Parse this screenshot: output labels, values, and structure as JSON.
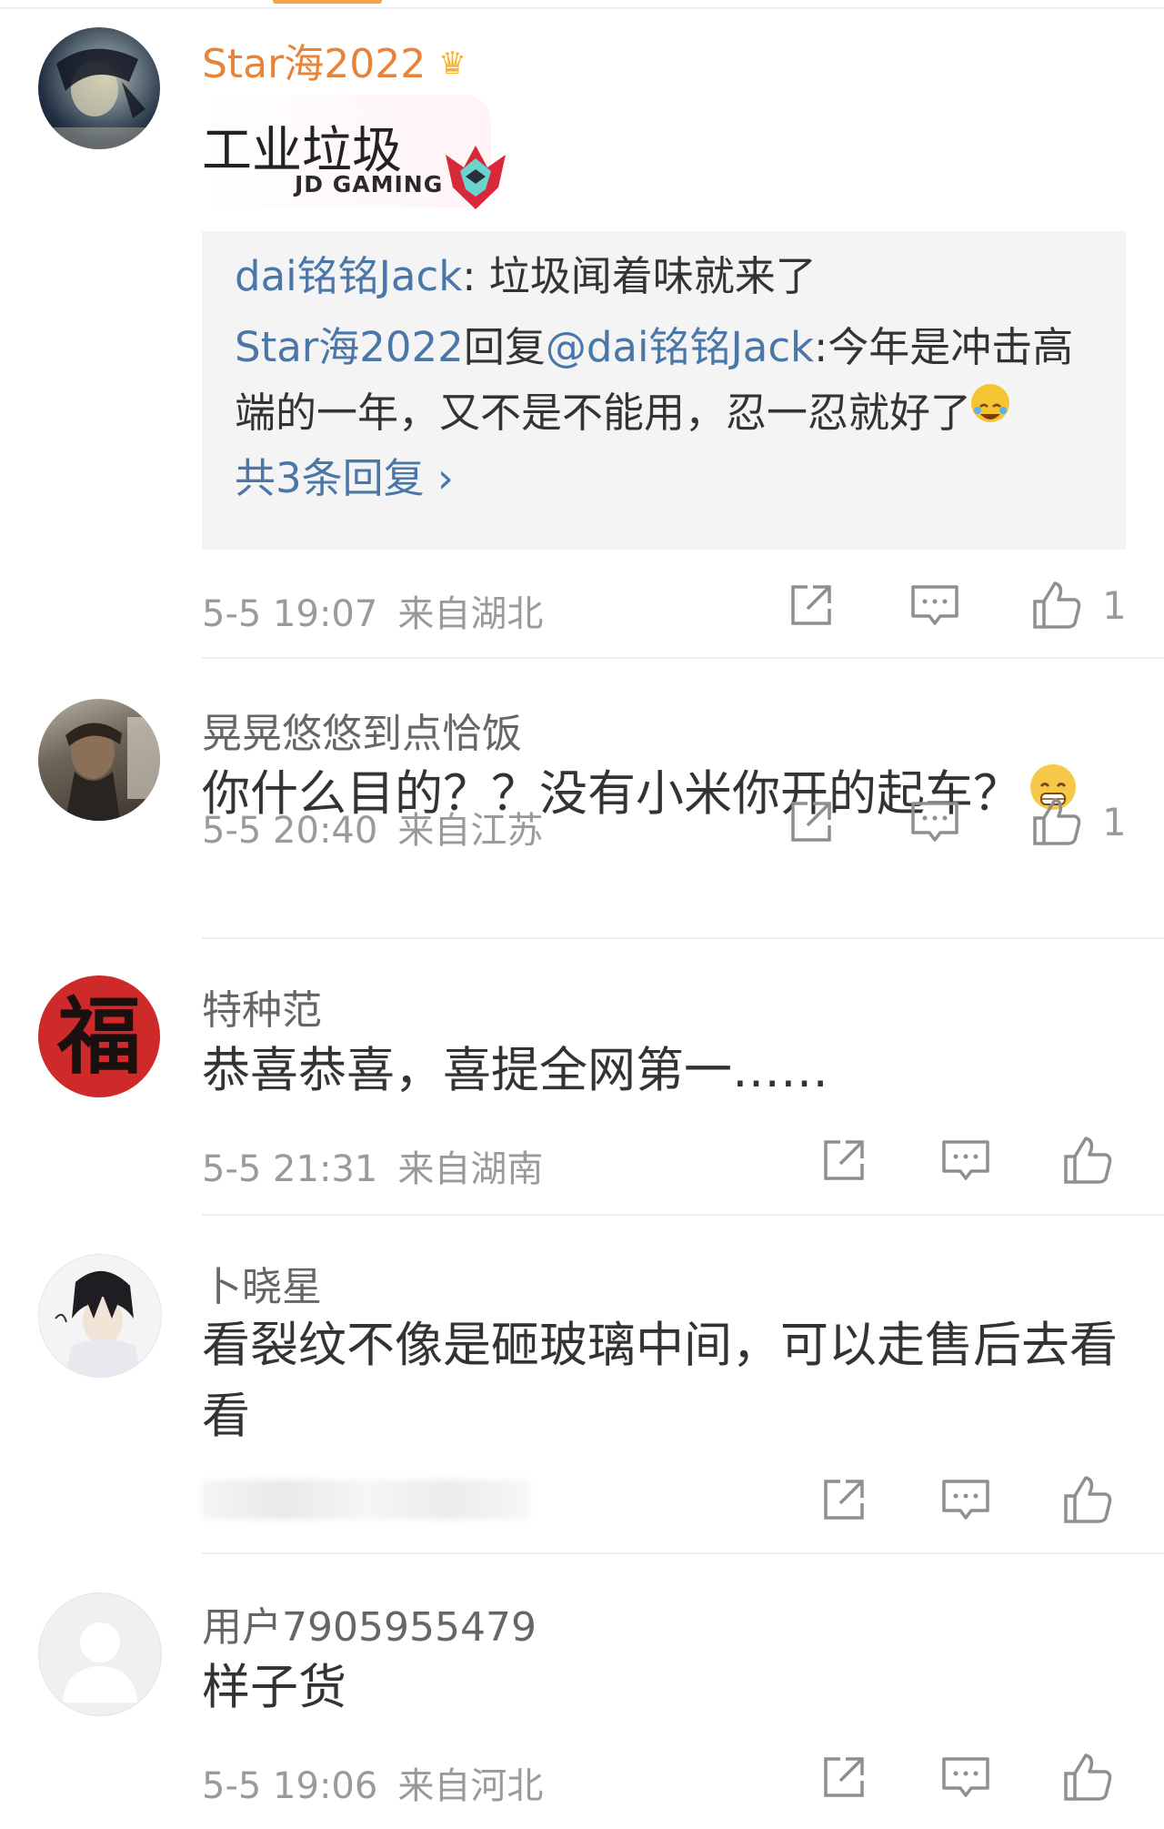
{
  "comments": [
    {
      "username": "Star海2022",
      "sticker": {
        "text": "工业垃圾",
        "brand": "JD GAMING"
      },
      "replies": {
        "line1_user": "dai铭铭Jack",
        "line1_text": ": 垃圾闻着味就来了",
        "line2_user": "Star海2022",
        "line2_mid": "回复",
        "line2_at": "@dai铭铭Jack",
        "line2_text": ":今年是冲击高端的一年，又不是不能用，忍一忍就好了",
        "more": "共3条回复 ›"
      },
      "time": "5-5 19:07",
      "location": "来自湖北",
      "likes": "1"
    },
    {
      "username": "晃晃悠悠到点恰饭",
      "text": "你什么目的？？没有小米你开的起车？",
      "time": "5-5 20:40",
      "location": "来自江苏",
      "likes": "1"
    },
    {
      "username": "特种范",
      "avatar_text": "福",
      "text": "恭喜恭喜，喜提全网第一……",
      "time": "5-5 21:31",
      "location": "来自湖南",
      "likes": ""
    },
    {
      "username": "卜晓星",
      "text": "看裂纹不像是砸玻璃中间，可以走售后去看看",
      "time": "",
      "location": "",
      "likes": ""
    },
    {
      "username": "用户7905955479",
      "text": "样子货",
      "time": "5-5 19:06",
      "location": "来自河北",
      "likes": ""
    }
  ],
  "icons": {
    "share": "share-icon",
    "comment": "comment-icon",
    "like": "thumbs-up-icon",
    "vip": "crown-icon"
  },
  "colors": {
    "vip_name": "#e8833a",
    "link": "#4a76a8",
    "meta": "#9a9a9a"
  }
}
